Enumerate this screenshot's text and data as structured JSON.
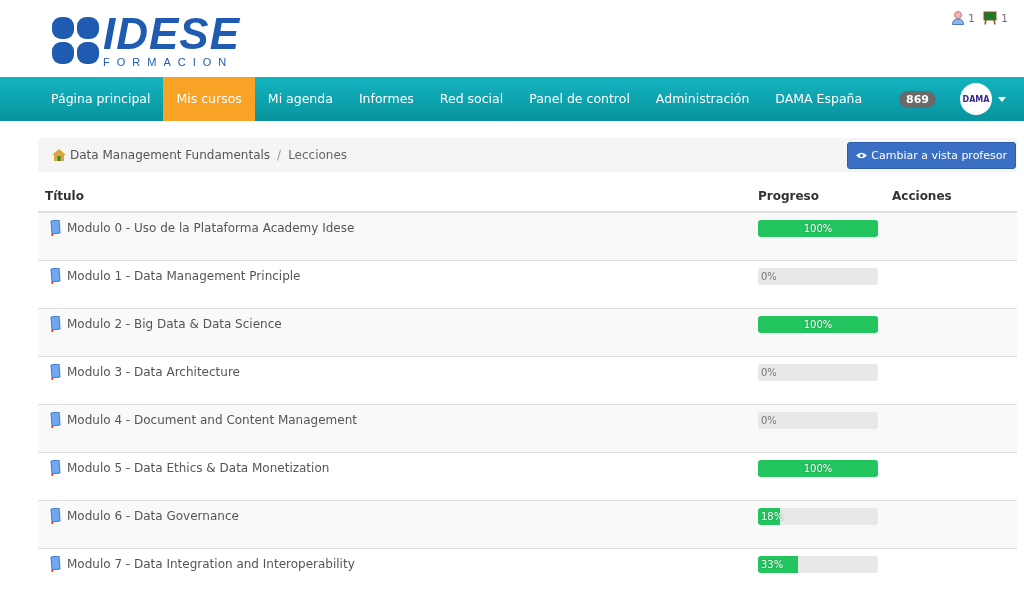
{
  "logo": {
    "name": "IDESE",
    "tagline": "FORMACION"
  },
  "notifications": [
    {
      "kind": "user",
      "count": "1"
    },
    {
      "kind": "board",
      "count": "1"
    }
  ],
  "nav": {
    "items": [
      {
        "label": "Página principal",
        "selected": false
      },
      {
        "label": "Mis cursos",
        "selected": true
      },
      {
        "label": "Mi agenda",
        "selected": false
      },
      {
        "label": "Informes",
        "selected": false
      },
      {
        "label": "Red social",
        "selected": false
      },
      {
        "label": "Panel de control",
        "selected": false
      },
      {
        "label": "Administración",
        "selected": false
      },
      {
        "label": "DAMA España",
        "selected": false
      }
    ],
    "badge": "869",
    "avatar_text": "DAMA"
  },
  "breadcrumb": [
    "Data Management Fundamentals",
    "Lecciones"
  ],
  "breadcrumb_separator": "/",
  "teacher_button": "Cambiar a vista profesor",
  "table": {
    "columns": [
      "Título",
      "Progreso",
      "Acciones"
    ],
    "rows": [
      {
        "title": "Modulo 0 - Uso de la Plataforma Academy Idese",
        "level": 1,
        "progress": "100%"
      },
      {
        "title": "Modulo 1 - Data Management Principle",
        "level": 0,
        "progress": "0%"
      },
      {
        "title": "Modulo 2 - Big Data & Data Science",
        "level": 1,
        "progress": "100%"
      },
      {
        "title": "Modulo 3 - Data Architecture",
        "level": 0,
        "progress": "0%"
      },
      {
        "title": "Modulo 4 - Document and Content Management",
        "level": 0,
        "progress": "0%"
      },
      {
        "title": "Modulo 5 - Data Ethics & Data Monetization",
        "level": 1,
        "progress": "100%"
      },
      {
        "title": "Modulo 6 - Data Governance",
        "level": 0.18,
        "progress": "18%"
      },
      {
        "title": "Modulo 7 - Data Integration and Interoperability",
        "level": 0.33,
        "progress": "33%"
      }
    ]
  }
}
